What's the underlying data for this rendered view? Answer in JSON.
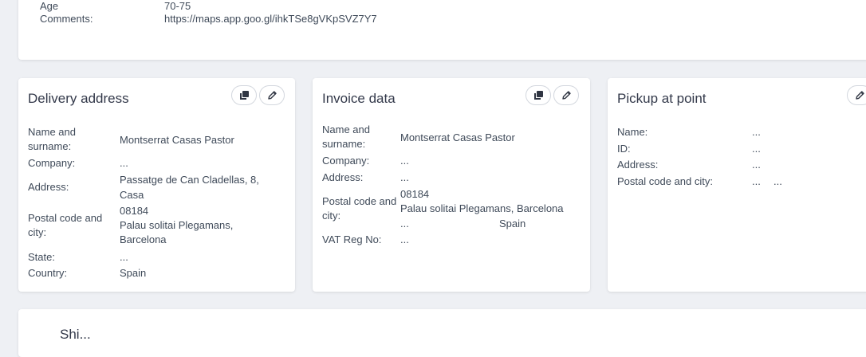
{
  "top_section": {
    "rows": [
      {
        "label": "Age",
        "value": "70-75"
      },
      {
        "label": "Comments:",
        "value": "https://maps.app.goo.gl/ihkTSe8gVKpSVZ7Y7"
      }
    ]
  },
  "delivery": {
    "title": "Delivery address",
    "labels": {
      "name": "Name and surname:",
      "company": "Company:",
      "address": "Address:",
      "postal": "Postal code and city:",
      "state": "State:",
      "country": "Country:"
    },
    "values": {
      "name": "Montserrat Casas Pastor",
      "company": "...",
      "address_line1": "Passatge de Can Cladellas, 8,",
      "address_line2": "Casa",
      "postal_code": "08184",
      "city_line1": "Palau solitai Plegamans,",
      "city_line2": "Barcelona",
      "state": "...",
      "country": "Spain"
    }
  },
  "invoice": {
    "title": "Invoice data",
    "labels": {
      "name": "Name and surname:",
      "company": "Company:",
      "address": "Address:",
      "postal": "Postal code and city:",
      "vat": "VAT Reg No:"
    },
    "values": {
      "name": "Montserrat Casas Pastor",
      "company": "...",
      "address": "...",
      "postal_code": "08184",
      "city": "Palau solitai Plegamans, Barcelona",
      "extra_a": "...",
      "extra_b": "Spain",
      "vat": "..."
    }
  },
  "pickup": {
    "title": "Pickup at point",
    "labels": {
      "name": "Name:",
      "id": "ID:",
      "address": "Address:",
      "postal": "Postal code and city:"
    },
    "values": {
      "name": "...",
      "id": "...",
      "address": "...",
      "postal_a": "...",
      "postal_b": "..."
    }
  },
  "bottom_section": {
    "title": "Shi..."
  },
  "icons": {
    "copy": "copy-icon",
    "edit": "pencil-icon"
  }
}
